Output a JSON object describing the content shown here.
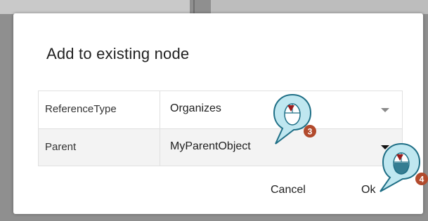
{
  "dialog": {
    "title": "Add to existing node",
    "rows": [
      {
        "label": "ReferenceType",
        "value": "Organizes"
      },
      {
        "label": "Parent",
        "value": "MyParentObject"
      }
    ],
    "cancel_label": "Cancel",
    "ok_label": "Ok"
  },
  "callouts": [
    {
      "number": "3",
      "icon": "mouse-click-icon"
    },
    {
      "number": "4",
      "icon": "mouse-click-icon"
    }
  ],
  "colors": {
    "callout_fill": "#bfe7f0",
    "callout_stroke": "#1f6f86",
    "badge": "#b24a2c",
    "mouse_button": "#9b1c1c"
  }
}
